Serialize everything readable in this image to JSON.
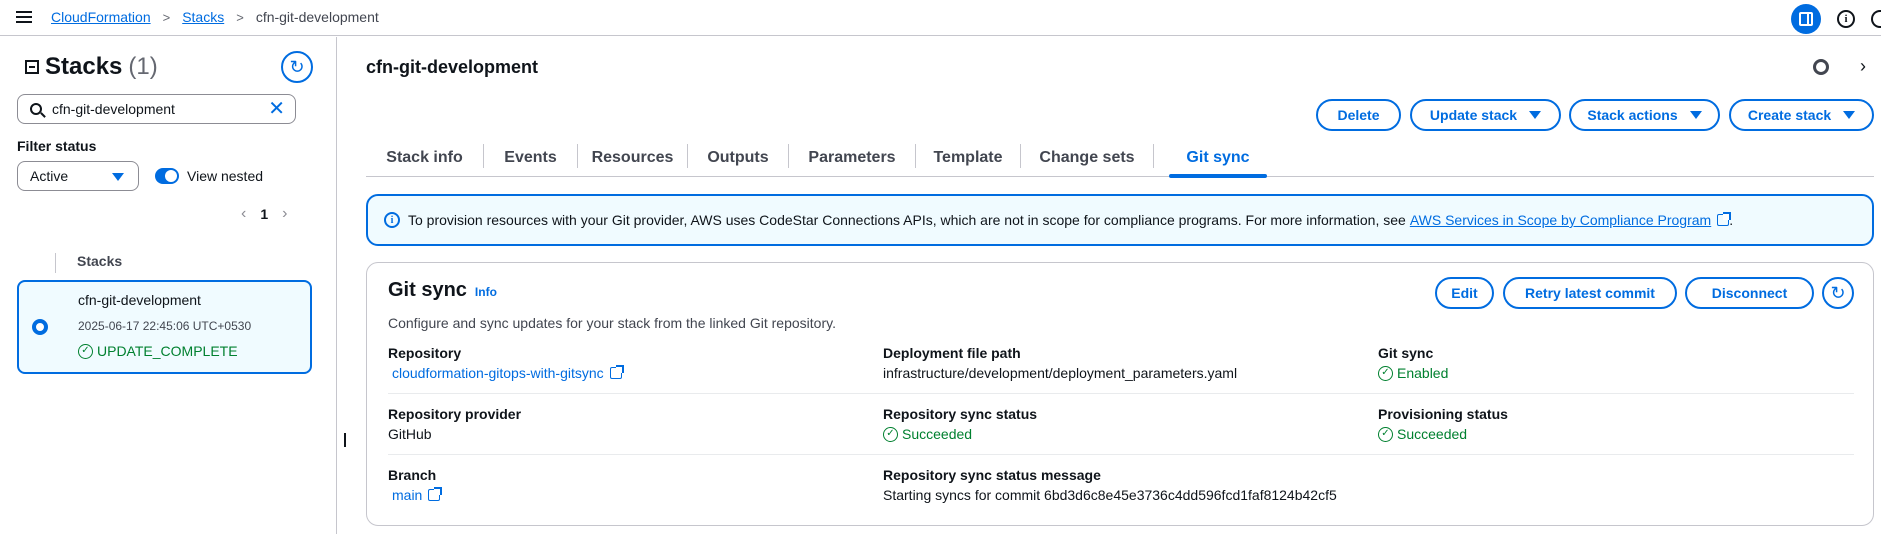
{
  "breadcrumbs": {
    "root": "CloudFormation",
    "section": "Stacks",
    "current": "cfn-git-development"
  },
  "left": {
    "title": "Stacks",
    "count": "(1)",
    "search_value": "cfn-git-development",
    "filter_label": "Filter status",
    "filter_value": "Active",
    "view_nested_label": "View nested",
    "page": "1",
    "column_header": "Stacks",
    "stack": {
      "name": "cfn-git-development",
      "date": "2025-06-17 22:45:06 UTC+0530",
      "status": "UPDATE_COMPLETE"
    }
  },
  "main": {
    "title": "cfn-git-development",
    "actions": {
      "delete": "Delete",
      "update": "Update stack",
      "stack_actions": "Stack actions",
      "create": "Create stack"
    },
    "tabs": [
      "Stack info",
      "Events",
      "Resources",
      "Outputs",
      "Parameters",
      "Template",
      "Change sets",
      "Git sync"
    ],
    "active_tab": "Git sync",
    "banner": {
      "text": "To provision resources with your Git provider, AWS uses CodeStar Connections APIs, which are not in scope for compliance programs. For more information, see",
      "link": "AWS Services in Scope by Compliance Program",
      "tail": "."
    },
    "gitsync": {
      "title": "Git sync",
      "info": "Info",
      "description": "Configure and sync updates for your stack from the linked Git repository.",
      "buttons": {
        "edit": "Edit",
        "retry": "Retry latest commit",
        "disconnect": "Disconnect"
      },
      "fields": {
        "repository_label": "Repository",
        "repository_value": "cloudformation-gitops-with-gitsync",
        "deployment_label": "Deployment file path",
        "deployment_value": "infrastructure/development/deployment_parameters.yaml",
        "gitsync_label": "Git sync",
        "gitsync_value": "Enabled",
        "provider_label": "Repository provider",
        "provider_value": "GitHub",
        "repo_status_label": "Repository sync status",
        "repo_status_value": "Succeeded",
        "prov_status_label": "Provisioning status",
        "prov_status_value": "Succeeded",
        "branch_label": "Branch",
        "branch_value": "main",
        "status_msg_label": "Repository sync status message",
        "status_msg_value": "Starting syncs for commit 6bd3d6c8e45e3736c4dd596fcd1faf8124b42cf5"
      }
    }
  },
  "colors": {
    "accent": "#006ce0",
    "success": "#00802f",
    "banner_bg": "#f0fbff"
  }
}
